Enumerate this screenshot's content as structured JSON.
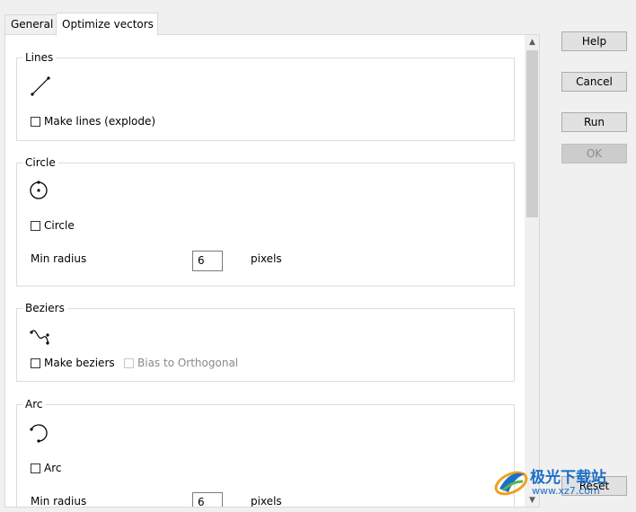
{
  "tabs": {
    "general": "General",
    "optimize": "Optimize vectors"
  },
  "lines": {
    "title": "Lines",
    "icon": "line-tool-icon",
    "make_lines_label": "Make lines (explode)",
    "make_lines_checked": false
  },
  "circle": {
    "title": "Circle",
    "icon": "circle-tool-icon",
    "circle_label": "Circle",
    "circle_checked": false,
    "min_radius_label": "Min radius",
    "min_radius_value": "6",
    "unit": "pixels"
  },
  "beziers": {
    "title": "Beziers",
    "icon": "bezier-tool-icon",
    "make_beziers_label": "Make beziers",
    "make_beziers_checked": false,
    "bias_label": "Bias to Orthogonal",
    "bias_enabled": false
  },
  "arc": {
    "title": "Arc",
    "icon": "arc-tool-icon",
    "arc_label": "Arc",
    "arc_checked": false,
    "min_radius_label": "Min radius",
    "min_radius_value": "6",
    "unit": "pixels"
  },
  "buttons": {
    "help": "Help",
    "cancel": "Cancel",
    "run": "Run",
    "ok": "OK",
    "reset": "Reset"
  },
  "watermark": {
    "title": "极光下载站",
    "url": "www.xz7.com"
  },
  "colors": {
    "panel_bg": "#ffffff",
    "window_bg": "#f0f0f0",
    "button_bg": "#e1e1e1",
    "disabled_text": "#8a8a8a",
    "watermark_blue": "#1c6fc7"
  }
}
